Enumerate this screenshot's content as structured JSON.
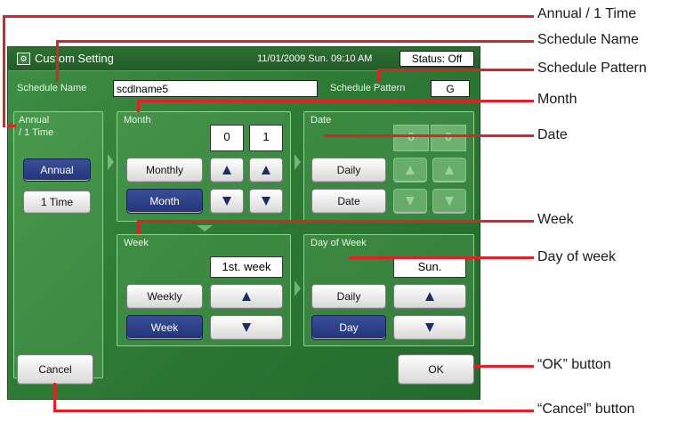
{
  "window": {
    "title": "Custom Setting",
    "datetime": "11/01/2009 Sun. 09:10 AM",
    "status": "Status: Off"
  },
  "schedule": {
    "name_label": "Schedule Name",
    "name_value": "scdlname5",
    "pattern_label": "Schedule Pattern",
    "pattern_value": "G"
  },
  "annual_panel": {
    "label_line1": "Annual",
    "label_line2": "/ 1 Time",
    "annual_btn": "Annual",
    "onetime_btn": "1 Time"
  },
  "month_panel": {
    "label": "Month",
    "digit1": "0",
    "digit2": "1",
    "monthly_btn": "Monthly",
    "month_btn": "Month"
  },
  "date_panel": {
    "label": "Date",
    "daily_btn": "Daily",
    "date_btn": "Date"
  },
  "week_panel": {
    "label": "Week",
    "value": "1st. week",
    "weekly_btn": "Weekly",
    "week_btn": "Week"
  },
  "dow_panel": {
    "label": "Day of Week",
    "value": "Sun.",
    "daily_btn": "Daily",
    "day_btn": "Day"
  },
  "footer": {
    "cancel": "Cancel",
    "ok": "OK"
  },
  "callouts": {
    "annual": "Annual / 1 Time",
    "schedule_name": "Schedule Name",
    "schedule_pattern": "Schedule Pattern",
    "month": "Month",
    "date": "Date",
    "week": "Week",
    "day_of_week": "Day of week",
    "ok_button": "“OK” button",
    "cancel_button": "“Cancel” button"
  },
  "colors": {
    "callout_red": "#e32026",
    "screen_green": "#2d7a35",
    "selected_blue": "#2a3c84"
  },
  "state": {
    "annual_selected": "Annual",
    "month_mode_selected": "Month",
    "week_mode_selected": "Week",
    "dow_mode_selected": "Day"
  }
}
